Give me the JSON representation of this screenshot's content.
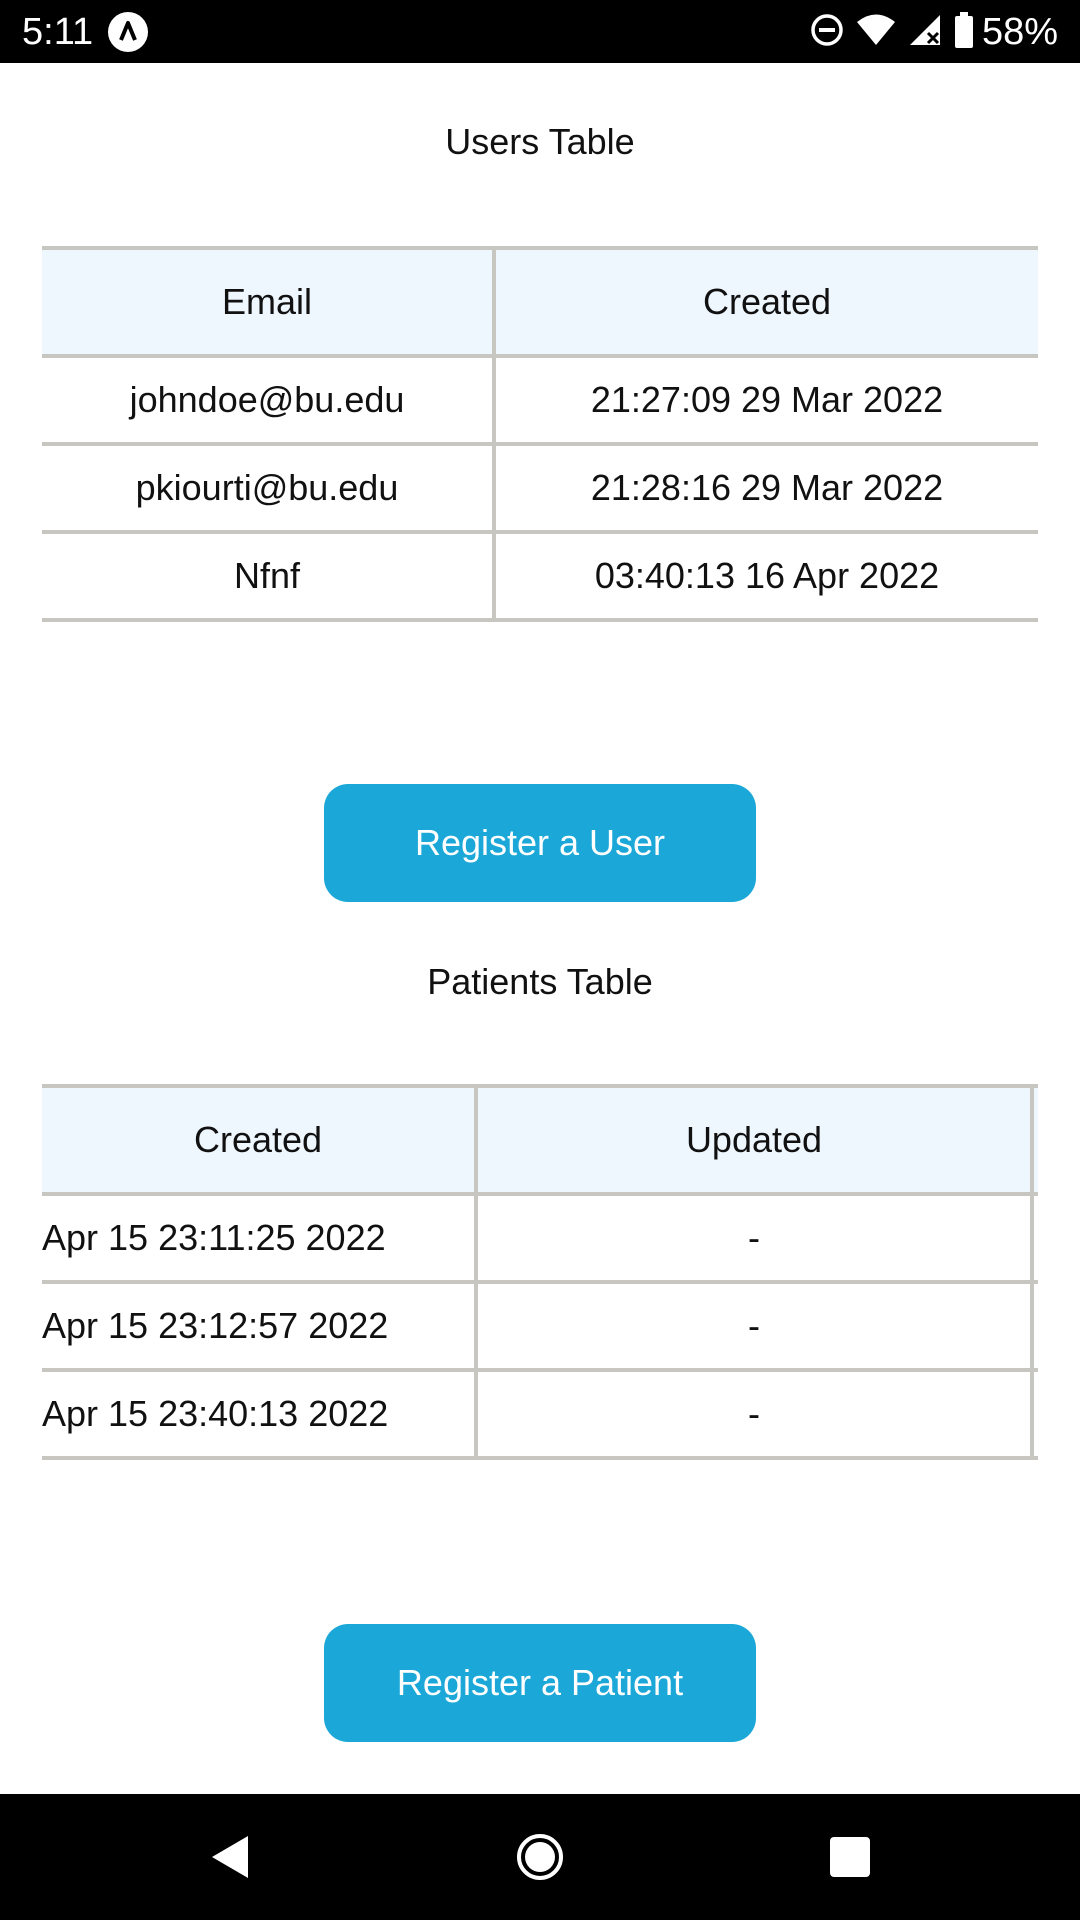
{
  "status_bar": {
    "time": "5:11",
    "battery": "58%",
    "icons": [
      "app-notification-icon",
      "do-not-disturb-icon",
      "wifi-icon",
      "cell-signal-icon",
      "battery-icon"
    ]
  },
  "users": {
    "title": "Users Table",
    "columns": [
      "Email",
      "Created"
    ],
    "rows": [
      [
        "johndoe@bu.edu",
        "21:27:09 29 Mar 2022"
      ],
      [
        "pkiourti@bu.edu",
        "21:28:16 29 Mar 2022"
      ],
      [
        "Nfnf",
        "03:40:13 16 Apr 2022"
      ]
    ],
    "button_label": "Register a User"
  },
  "patients": {
    "title": "Patients Table",
    "columns": [
      "Created",
      "Updated"
    ],
    "rows": [
      [
        "Apr 15 23:11:25 2022",
        "-"
      ],
      [
        "Apr 15 23:12:57 2022",
        "-"
      ],
      [
        "Apr 15 23:40:13 2022",
        "-"
      ]
    ],
    "button_label": "Register a Patient"
  },
  "nav_bar": {
    "icons": [
      "back-icon",
      "home-icon",
      "recents-icon"
    ]
  },
  "colors": {
    "accent": "#1ba8d8",
    "header_bg": "#eef6fe",
    "border": "#c8c6c1"
  }
}
